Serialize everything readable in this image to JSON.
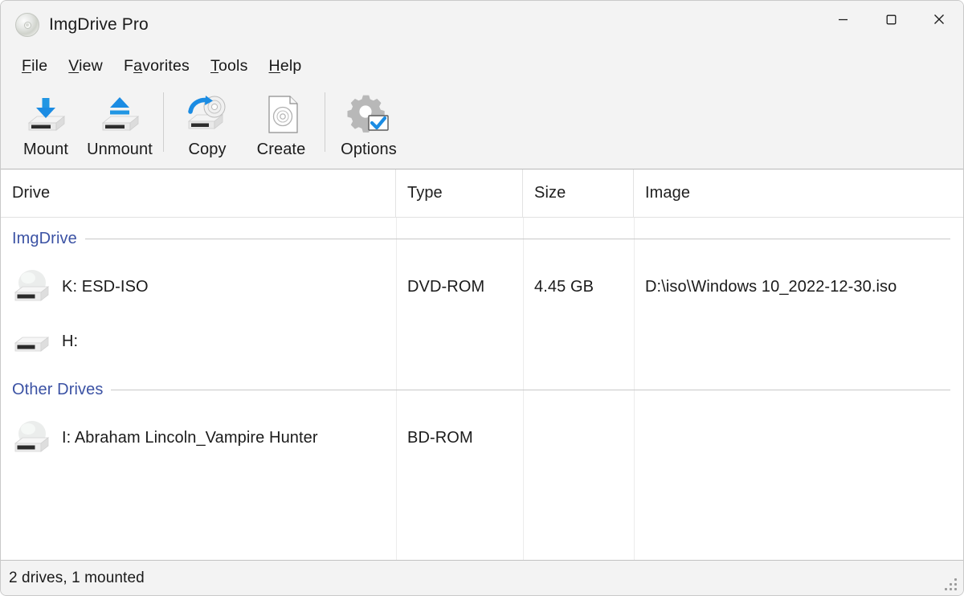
{
  "window": {
    "title": "ImgDrive Pro",
    "icon": "disc-icon",
    "controls": {
      "minimize": "─",
      "maximize": "□",
      "close": "✕",
      "minimize_name": "minimize",
      "maximize_name": "maximize",
      "close_name": "close"
    }
  },
  "menubar": {
    "items": [
      {
        "label": "File",
        "accel": "F",
        "rest": "ile"
      },
      {
        "label": "View",
        "accel": "V",
        "rest": "iew"
      },
      {
        "label": "Favorites",
        "accel": "a",
        "pre": "F",
        "rest": "vorites"
      },
      {
        "label": "Tools",
        "accel": "T",
        "rest": "ools"
      },
      {
        "label": "Help",
        "accel": "H",
        "rest": "elp"
      }
    ]
  },
  "toolbar": {
    "mount_label": "Mount",
    "unmount_label": "Unmount",
    "copy_label": "Copy",
    "create_label": "Create",
    "options_label": "Options",
    "icons": {
      "mount": "drive-download-icon",
      "unmount": "drive-eject-icon",
      "copy": "drive-disc-copy-icon",
      "create": "document-disc-icon",
      "options": "gear-check-icon"
    }
  },
  "list": {
    "columns": [
      {
        "key": "drive",
        "label": "Drive"
      },
      {
        "key": "type",
        "label": "Type"
      },
      {
        "key": "size",
        "label": "Size"
      },
      {
        "key": "image",
        "label": "Image"
      }
    ],
    "groups": [
      {
        "name": "ImgDrive",
        "rows": [
          {
            "icon": "drive-with-disc-icon",
            "drive": "K: ESD-ISO",
            "type": "DVD-ROM",
            "size": "4.45 GB",
            "image": "D:\\iso\\Windows 10_2022-12-30.iso"
          },
          {
            "icon": "drive-empty-icon",
            "drive": "H:",
            "type": "",
            "size": "",
            "image": ""
          }
        ]
      },
      {
        "name": "Other Drives",
        "rows": [
          {
            "icon": "drive-with-disc-icon",
            "drive": "I: Abraham Lincoln_Vampire Hunter",
            "type": "BD-ROM",
            "size": "",
            "image": ""
          }
        ]
      }
    ]
  },
  "statusbar": {
    "text": "2 drives, 1 mounted",
    "grip": "resize-grip-icon"
  },
  "colors": {
    "group_header": "#3b52a4",
    "accent_blue": "#1b8ce3",
    "window_bg": "#f3f3f3",
    "list_bg": "#ffffff",
    "text": "#1b1b1b"
  }
}
